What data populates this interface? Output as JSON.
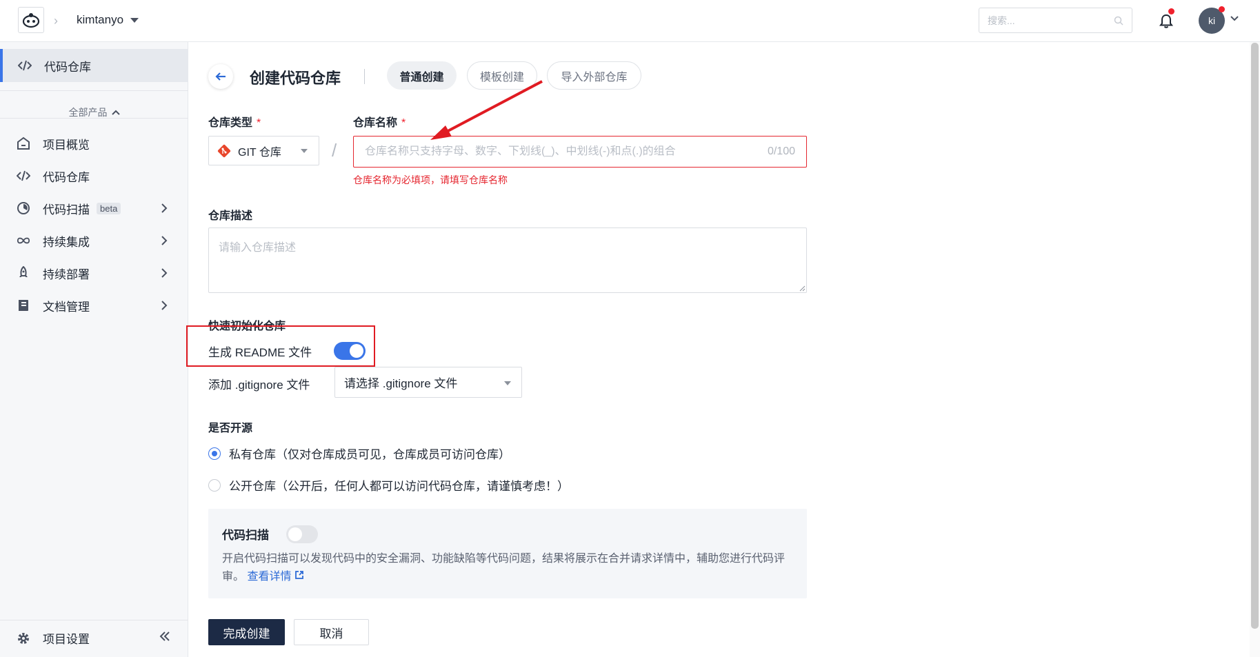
{
  "topbar": {
    "team": "kimtanyo",
    "search_placeholder": "搜索...",
    "avatar_initials": "ki"
  },
  "sidebar": {
    "active_item": "代码仓库",
    "all_products": "全部产品",
    "items": [
      {
        "label": "项目概览",
        "icon": "home-icon",
        "has_arrow": false
      },
      {
        "label": "代码仓库",
        "icon": "code-icon",
        "has_arrow": false
      },
      {
        "label": "代码扫描",
        "icon": "scan-icon",
        "has_arrow": true,
        "badge": "beta"
      },
      {
        "label": "持续集成",
        "icon": "infinity-icon",
        "has_arrow": true
      },
      {
        "label": "持续部署",
        "icon": "rocket-icon",
        "has_arrow": true
      },
      {
        "label": "文档管理",
        "icon": "document-icon",
        "has_arrow": true
      }
    ],
    "settings": "项目设置"
  },
  "main": {
    "title": "创建代码仓库",
    "tabs": [
      {
        "label": "普通创建",
        "active": true
      },
      {
        "label": "模板创建",
        "active": false
      },
      {
        "label": "导入外部仓库",
        "active": false
      }
    ],
    "repo_type": {
      "label": "仓库类型",
      "required": "*",
      "value": "GIT 仓库"
    },
    "repo_name": {
      "label": "仓库名称",
      "required": "*",
      "placeholder": "仓库名称只支持字母、数字、下划线(_)、中划线(-)和点(.)的组合",
      "counter": "0/100",
      "error": "仓库名称为必填项，请填写仓库名称"
    },
    "repo_desc": {
      "label": "仓库描述",
      "placeholder": "请输入仓库描述"
    },
    "quick_init": {
      "label": "快速初始化仓库",
      "readme_label": "生成 README 文件",
      "readme_on": true,
      "gitignore_label": "添加 .gitignore 文件",
      "gitignore_placeholder": "请选择 .gitignore 文件"
    },
    "visibility": {
      "label": "是否开源",
      "options": [
        {
          "label": "私有仓库（仅对仓库成员可见，仓库成员可访问仓库）",
          "checked": true
        },
        {
          "label": "公开仓库（公开后，任何人都可以访问代码仓库，请谨慎考虑！）",
          "checked": false
        }
      ]
    },
    "code_scan": {
      "title": "代码扫描",
      "enabled": false,
      "desc": "开启代码扫描可以发现代码中的安全漏洞、功能缺陷等代码问题，结果将展示在合并请求详情中，辅助您进行代码评审。",
      "link": "查看详情"
    },
    "buttons": {
      "submit": "完成创建",
      "cancel": "取消"
    }
  },
  "colors": {
    "accent": "#3a75e8",
    "error": "#e5262f",
    "primary_button": "#1c2a45",
    "annotation": "#e01b22"
  }
}
